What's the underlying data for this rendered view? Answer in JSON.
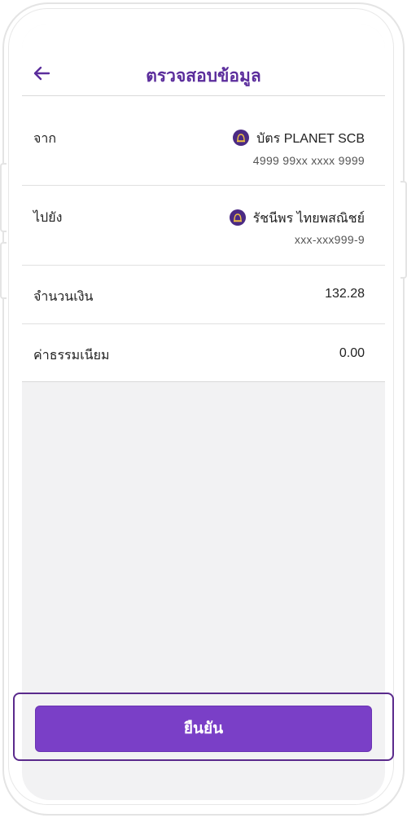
{
  "header": {
    "title": "ตรวจสอบข้อมูล",
    "back_icon": "arrow-left-icon"
  },
  "colors": {
    "accent": "#5b2d9c",
    "button": "#7a3fc7",
    "background": "#f2f2f3"
  },
  "details": {
    "from": {
      "label": "จาก",
      "name": "บัตร PLANET SCB",
      "number": "4999 99xx xxxx 9999",
      "icon": "scb-logo-icon"
    },
    "to": {
      "label": "ไปยัง",
      "name": "รัชนีพร ไทยพสณิชย์",
      "number": "xxx-xxx999-9",
      "icon": "scb-logo-icon"
    },
    "amount": {
      "label": "จำนวนเงิน",
      "value": "132.28"
    },
    "fee": {
      "label": "ค่าธรรมเนียม",
      "value": "0.00"
    }
  },
  "footer": {
    "confirm_label": "ยืนยัน"
  }
}
